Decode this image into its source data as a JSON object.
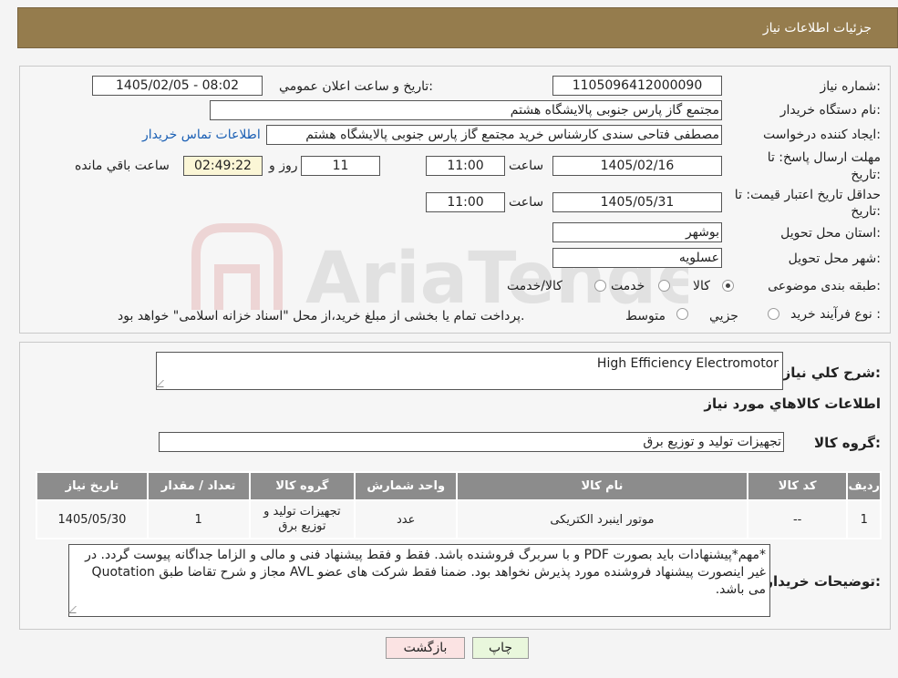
{
  "header": {
    "title": "جزئیات اطلاعات نیاز"
  },
  "form": {
    "need_number_label": "شماره نیاز:",
    "need_number": "1105096412000090",
    "announce_label": "تاریخ و ساعت اعلان عمومي:",
    "announce_value": "1405/02/05 - 08:02",
    "buyer_org_label": "نام دستگاه خريدار:",
    "buyer_org": "مجتمع گاز پارس جنوبی  پالایشگاه هشتم",
    "creator_label": "ايجاد کننده درخواست:",
    "creator": "مصطفی فتاحی سندی کارشناس خرید مجتمع گاز پارس جنوبی  پالایشگاه هشتم",
    "contact_link": "اطلاعات تماس خريدار",
    "deadline_label_1": "مهلت ارسال پاسخ: تا",
    "deadline_label_2": "تاريخ:",
    "deadline_date": "1405/02/16",
    "time_label": "ساعت",
    "deadline_time": "11:00",
    "days_value": "11",
    "days_label": "روز و",
    "remaining_time": "02:49:22",
    "remaining_label": "ساعت باقي مانده",
    "validity_label_1": "حداقل تاريخ اعتبار قيمت: تا",
    "validity_label_2": "تاريخ:",
    "validity_date": "1405/05/31",
    "validity_time": "11:00",
    "province_label": "استان محل تحويل:",
    "province": "بوشهر",
    "city_label": "شهر محل تحويل:",
    "city": "عسلویه",
    "category_label": "طبقه بندی موضوعی:",
    "category_options": [
      "کالا",
      "خدمت",
      "کالا/خدمت"
    ],
    "category_selected": "کالا",
    "process_label": "نوع فرآيند خريد :",
    "process_options": [
      "جزيي",
      "متوسط"
    ],
    "process_note": "پرداخت تمام یا بخشی از مبلغ خرید،از محل \"اسناد خزانه اسلامی\" خواهد بود."
  },
  "watermark": {
    "text": "AriaTender.neT"
  },
  "details": {
    "summary_label": "شرح کلي نياز:",
    "summary": "High Efficiency Electromotor",
    "goods_title": "اطلاعات کالاهاي مورد نياز",
    "group_label": "گروه کالا:",
    "group": "تجهيزات توليد و توزيع برق",
    "table": {
      "headers": [
        "رديف",
        "کد کالا",
        "نام کالا",
        "واحد شمارش",
        "گروه کالا",
        "تعداد / مقدار",
        "تاريخ نياز"
      ],
      "rows": [
        {
          "row": "1",
          "code": "--",
          "name": "موتور اینبرد الکتریکی",
          "unit": "عدد",
          "group": "تجهيزات توليد و توزيع برق",
          "qty": "1",
          "date": "1405/05/30"
        }
      ]
    },
    "notes_label": "توضيحات خريدار:",
    "notes": "*مهم*پیشنهادات باید بصورت PDF و با سربرگ فروشنده باشد. فقط و فقط پیشنهاد فنی و مالی و الزاما جداگانه پیوست گردد. در غیر اینصورت پیشنهاد فروشنده مورد پذیرش نخواهد بود. ضمنا فقط شرکت های عضو AVL مجاز و شرح تقاضا طبق Quotation می باشد."
  },
  "buttons": {
    "print": "چاپ",
    "back": "بازگشت"
  },
  "colors": {
    "header_bg": "#957c4d",
    "table_header_bg": "#8c8c8c",
    "link": "#1a5fb4",
    "print_bg": "#e9f7dc",
    "back_bg": "#fbe3e3"
  }
}
